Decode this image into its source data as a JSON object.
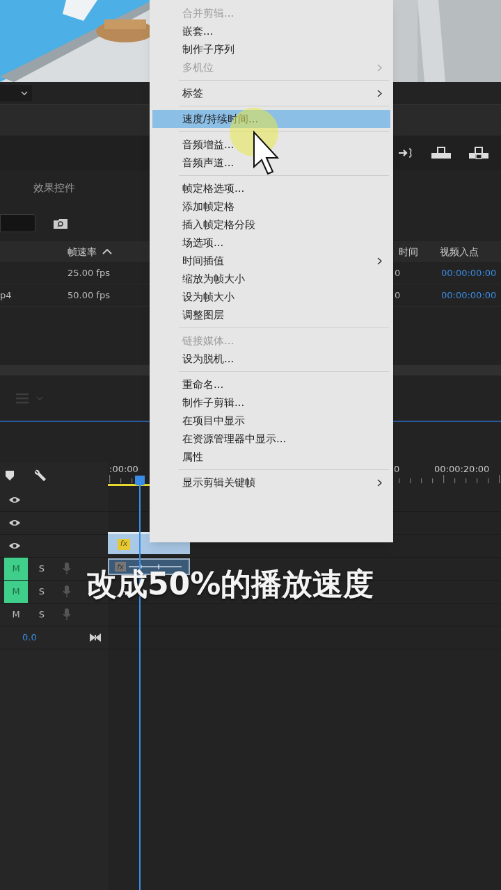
{
  "panel": {
    "tab": "效果控件",
    "columns": [
      {
        "label": "帧速率",
        "sorted": true
      },
      {
        "label": "时间",
        "sorted": false
      },
      {
        "label": "视频入点",
        "sorted": false
      }
    ],
    "rows": [
      {
        "cells": [
          "25.00 fps",
          "0",
          "00:00:00:00"
        ]
      },
      {
        "name": "p4",
        "cells": [
          "50.00 fps",
          "0",
          "00:00:00:00"
        ]
      }
    ]
  },
  "timeline": {
    "ruler": [
      ":00:00",
      "0",
      "00:00:20:00"
    ],
    "clips": [
      {
        "badge": "fx"
      },
      {
        "badge": "fx"
      }
    ],
    "tracks": [
      {
        "kind": "video"
      },
      {
        "kind": "video"
      },
      {
        "kind": "video"
      },
      {
        "kind": "audio",
        "mute_label": "M",
        "solo_label": "S",
        "muted": true
      },
      {
        "kind": "audio",
        "mute_label": "M",
        "solo_label": "S",
        "muted": true
      },
      {
        "kind": "audio",
        "mute_label": "M",
        "solo_label": "S",
        "muted": false
      },
      {
        "kind": "master",
        "volume": "0.0"
      }
    ]
  },
  "context_menu": {
    "items": [
      {
        "kind": "item",
        "label": "合并剪辑...",
        "disabled": true,
        "submenu": false,
        "selected": false
      },
      {
        "kind": "item",
        "label": "嵌套...",
        "disabled": false,
        "submenu": false,
        "selected": false
      },
      {
        "kind": "item",
        "label": "制作子序列",
        "disabled": false,
        "submenu": false,
        "selected": false
      },
      {
        "kind": "item",
        "label": "多机位",
        "disabled": true,
        "submenu": true,
        "selected": false
      },
      {
        "kind": "separator"
      },
      {
        "kind": "item",
        "label": "标签",
        "disabled": false,
        "submenu": true,
        "selected": false
      },
      {
        "kind": "separator"
      },
      {
        "kind": "item",
        "label": "速度/持续时间...",
        "disabled": false,
        "submenu": false,
        "selected": true
      },
      {
        "kind": "separator"
      },
      {
        "kind": "item",
        "label": "音频增益...",
        "disabled": false,
        "submenu": false,
        "selected": false
      },
      {
        "kind": "item",
        "label": "音频声道...",
        "disabled": false,
        "submenu": false,
        "selected": false
      },
      {
        "kind": "separator"
      },
      {
        "kind": "item",
        "label": "帧定格选项...",
        "disabled": false,
        "submenu": false,
        "selected": false
      },
      {
        "kind": "item",
        "label": "添加帧定格",
        "disabled": false,
        "submenu": false,
        "selected": false
      },
      {
        "kind": "item",
        "label": "插入帧定格分段",
        "disabled": false,
        "submenu": false,
        "selected": false
      },
      {
        "kind": "item",
        "label": "场选项...",
        "disabled": false,
        "submenu": false,
        "selected": false
      },
      {
        "kind": "item",
        "label": "时间插值",
        "disabled": false,
        "submenu": true,
        "selected": false
      },
      {
        "kind": "item",
        "label": "缩放为帧大小",
        "disabled": false,
        "submenu": false,
        "selected": false
      },
      {
        "kind": "item",
        "label": "设为帧大小",
        "disabled": false,
        "submenu": false,
        "selected": false
      },
      {
        "kind": "item",
        "label": "调整图层",
        "disabled": false,
        "submenu": false,
        "selected": false
      },
      {
        "kind": "separator"
      },
      {
        "kind": "item",
        "label": "链接媒体...",
        "disabled": true,
        "submenu": false,
        "selected": false
      },
      {
        "kind": "item",
        "label": "设为脱机...",
        "disabled": false,
        "submenu": false,
        "selected": false
      },
      {
        "kind": "separator"
      },
      {
        "kind": "item",
        "label": "重命名...",
        "disabled": false,
        "submenu": false,
        "selected": false
      },
      {
        "kind": "item",
        "label": "制作子剪辑...",
        "disabled": false,
        "submenu": false,
        "selected": false
      },
      {
        "kind": "item",
        "label": "在项目中显示",
        "disabled": false,
        "submenu": false,
        "selected": false
      },
      {
        "kind": "item",
        "label": "在资源管理器中显示...",
        "disabled": false,
        "submenu": false,
        "selected": false
      },
      {
        "kind": "item",
        "label": "属性",
        "disabled": false,
        "submenu": false,
        "selected": false
      },
      {
        "kind": "separator"
      },
      {
        "kind": "item",
        "label": "显示剪辑关键帧",
        "disabled": false,
        "submenu": true,
        "selected": false
      }
    ]
  },
  "caption": "改成50%的播放速度"
}
